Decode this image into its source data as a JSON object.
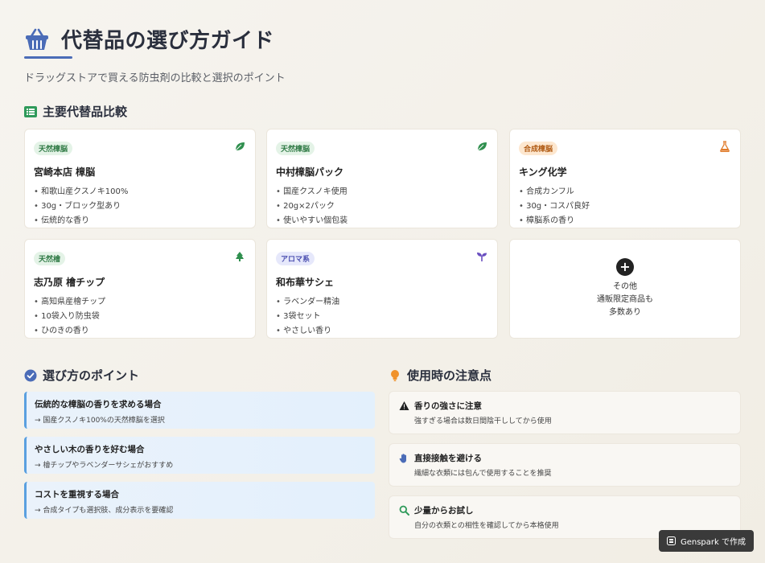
{
  "header": {
    "title": "代替品の選び方ガイド",
    "subtitle": "ドラッグストアで買える防虫剤の比較と選択のポイント",
    "icon": "basket-icon"
  },
  "comparison": {
    "heading": "主要代替品比較",
    "cards": [
      {
        "badge": "天然樟脳",
        "name": "宮崎本店 樟脳",
        "icon": "leaf-icon",
        "items": [
          "和歌山産クスノキ100%",
          "30g・ブロック型あり",
          "伝統的な香り"
        ]
      },
      {
        "badge": "天然樟脳",
        "name": "中村樟脳パック",
        "icon": "leaf-icon",
        "items": [
          "国産クスノキ使用",
          "20g×2パック",
          "使いやすい個包装"
        ]
      },
      {
        "badge": "合成樟脳",
        "name": "キング化学",
        "icon": "flask-icon",
        "items": [
          "合成カンフル",
          "30g・コスパ良好",
          "樟脳系の香り"
        ]
      },
      {
        "badge": "天然檜",
        "name": "志乃原 檜チップ",
        "icon": "tree-icon",
        "items": [
          "高知県産檜チップ",
          "10袋入り防虫袋",
          "ひのきの香り"
        ]
      },
      {
        "badge": "アロマ系",
        "name": "和布華サシェ",
        "icon": "sprout-icon",
        "items": [
          "ラベンダー精油",
          "3袋セット",
          "やさしい香り"
        ]
      }
    ],
    "other": {
      "line1": "その他",
      "line2": "通販限定商品も",
      "line3": "多数あり"
    }
  },
  "points": {
    "heading": "選び方のポイント",
    "items": [
      {
        "title": "伝統的な樟脳の香りを求める場合",
        "desc": "→ 国産クスノキ100%の天然樟脳を選択"
      },
      {
        "title": "やさしい木の香りを好む場合",
        "desc": "→ 檜チップやラベンダーサシェがおすすめ"
      },
      {
        "title": "コストを重視する場合",
        "desc": "→ 合成タイプも選択肢、成分表示を要確認"
      }
    ]
  },
  "cautions": {
    "heading": "使用時の注意点",
    "items": [
      {
        "title": "香りの強さに注意",
        "desc": "強すぎる場合は数日間陰干ししてから使用",
        "icon": "warning-icon"
      },
      {
        "title": "直接接触を避ける",
        "desc": "繊細な衣類には包んで使用することを推奨",
        "icon": "hand-icon"
      },
      {
        "title": "少量からお試し",
        "desc": "自分の衣類との相性を確認してから本格使用",
        "icon": "search-icon"
      }
    ]
  },
  "footer": {
    "badge": "Genspark で作成"
  },
  "colors": {
    "accent": "#4b6cb7",
    "leaf": "#2f8f4e",
    "flask": "#e07b2a",
    "aroma": "#6a4fc0",
    "point_border": "#5aa0e0"
  }
}
